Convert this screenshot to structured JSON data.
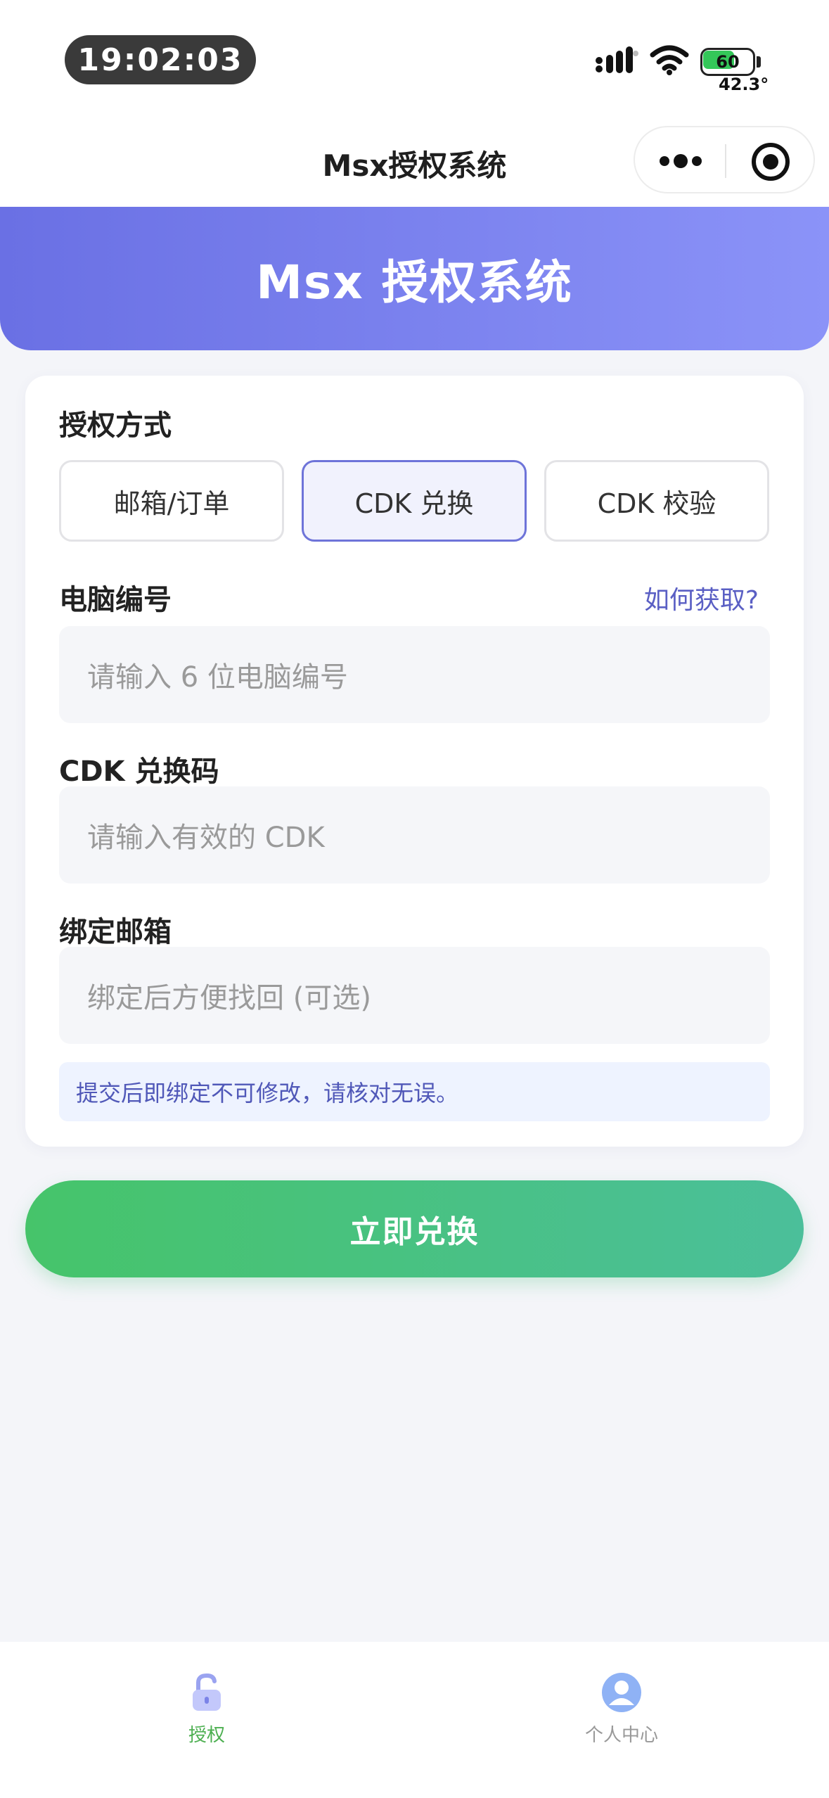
{
  "status_bar": {
    "time": "19:02:03",
    "battery_level": "60",
    "temperature": "42.3°",
    "icons": [
      "signal-icon",
      "wifi-icon",
      "battery-icon"
    ]
  },
  "navbar": {
    "title": "Msx授权系统",
    "capsule_icons": [
      "more-icon",
      "target-icon"
    ]
  },
  "banner": {
    "title": "Msx 授权系统"
  },
  "form": {
    "mode_label": "授权方式",
    "modes": [
      {
        "label": "邮箱/订单",
        "active": false
      },
      {
        "label": "CDK 兑换",
        "active": true
      },
      {
        "label": "CDK 校验",
        "active": false
      }
    ],
    "pc_label": "电脑编号",
    "help_link": "如何获取?",
    "pc_placeholder": "请输入 6 位电脑编号",
    "cdk_label": "CDK 兑换码",
    "cdk_placeholder": "请输入有效的 CDK",
    "email_label": "绑定邮箱",
    "email_placeholder": "绑定后方便找回 (可选)",
    "notice": "提交后即绑定不可修改，请核对无误。"
  },
  "submit_label": "立即兑换",
  "tabbar": {
    "tabs": [
      {
        "label": "授权",
        "icon": "lock-icon",
        "active": true
      },
      {
        "label": "个人中心",
        "icon": "user-icon",
        "active": false
      }
    ]
  },
  "colors": {
    "primary": "#6a70e4",
    "accent_green": "#46c46a",
    "link": "#5a5fc4",
    "tab_active": "#4caf50",
    "tab_inactive": "#999999"
  }
}
